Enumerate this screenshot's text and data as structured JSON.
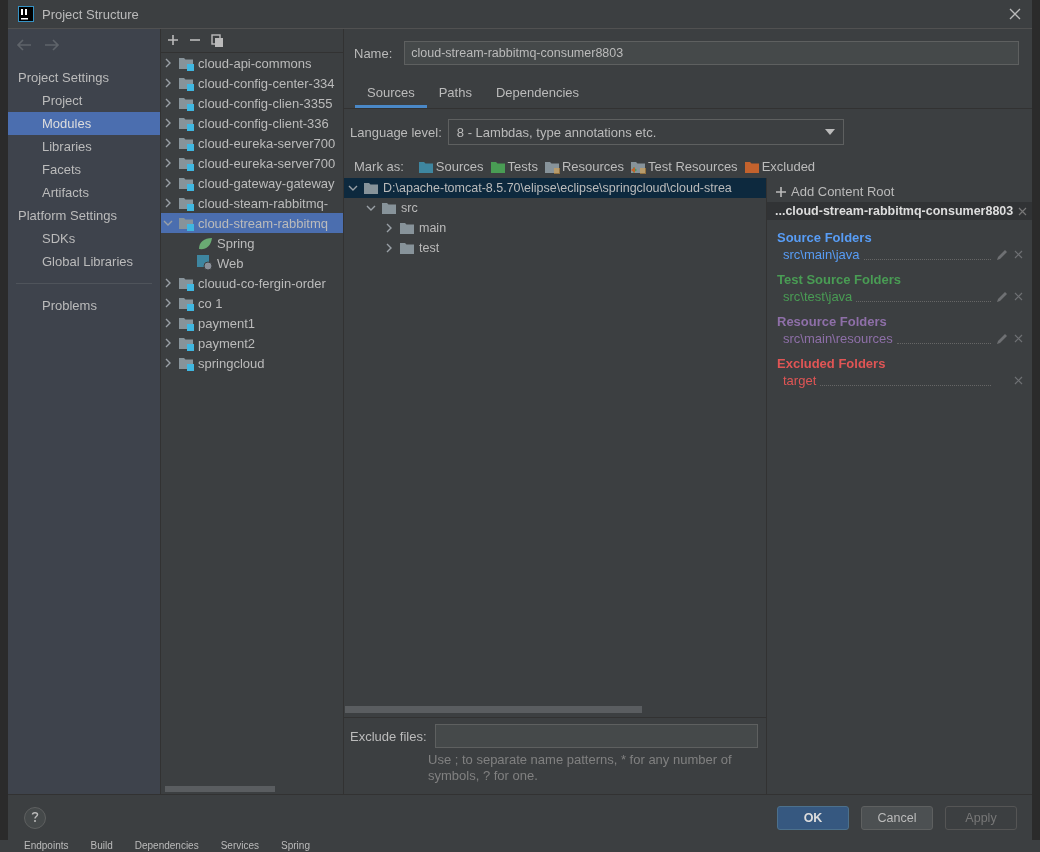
{
  "window": {
    "title": "Project Structure"
  },
  "nav": {
    "sections": [
      {
        "heading": "Project Settings",
        "items": [
          {
            "label": "Project",
            "selected": false
          },
          {
            "label": "Modules",
            "selected": true
          },
          {
            "label": "Libraries",
            "selected": false
          },
          {
            "label": "Facets",
            "selected": false
          },
          {
            "label": "Artifacts",
            "selected": false
          }
        ]
      },
      {
        "heading": "Platform Settings",
        "items": [
          {
            "label": "SDKs",
            "selected": false
          },
          {
            "label": "Global Libraries",
            "selected": false
          }
        ]
      }
    ],
    "extra_items": [
      {
        "label": "Problems",
        "selected": false
      }
    ]
  },
  "modules": [
    {
      "label": "cloud-api-commons",
      "expanded": false,
      "selected": false
    },
    {
      "label": "cloud-config-center-334",
      "expanded": false,
      "selected": false
    },
    {
      "label": "cloud-config-clien-3355",
      "expanded": false,
      "selected": false
    },
    {
      "label": "cloud-config-client-336",
      "expanded": false,
      "selected": false
    },
    {
      "label": "cloud-eureka-server700",
      "expanded": false,
      "selected": false
    },
    {
      "label": "cloud-eureka-server700",
      "expanded": false,
      "selected": false
    },
    {
      "label": "cloud-gateway-gateway",
      "expanded": false,
      "selected": false
    },
    {
      "label": "cloud-steam-rabbitmq-",
      "expanded": false,
      "selected": false
    },
    {
      "label": "cloud-stream-rabbitmq",
      "expanded": true,
      "selected": true,
      "children": [
        {
          "label": "Spring",
          "kind": "spring"
        },
        {
          "label": "Web",
          "kind": "web"
        }
      ]
    },
    {
      "label": "clouud-co-fergin-order",
      "expanded": false,
      "selected": false
    },
    {
      "label": "co 1",
      "expanded": false,
      "selected": false
    },
    {
      "label": "payment1",
      "expanded": false,
      "selected": false
    },
    {
      "label": "payment2",
      "expanded": false,
      "selected": false
    },
    {
      "label": "springcloud",
      "expanded": false,
      "selected": false
    }
  ],
  "name_field": {
    "label": "Name:",
    "value": "cloud-stream-rabbitmq-consumer8803"
  },
  "tabs": [
    {
      "label": "Sources",
      "selected": true
    },
    {
      "label": "Paths",
      "selected": false
    },
    {
      "label": "Dependencies",
      "selected": false
    }
  ],
  "language_level": {
    "label": "Language level:",
    "value": "8 - Lambdas, type annotations etc."
  },
  "mark_as": {
    "label": "Mark as:",
    "items": [
      {
        "label": "Sources",
        "kind": "plain",
        "color": "#3e86a0"
      },
      {
        "label": "Tests",
        "kind": "plain",
        "color": "#499c54"
      },
      {
        "label": "Resources",
        "kind": "resources",
        "color": "#87939a"
      },
      {
        "label": "Test Resources",
        "kind": "test-resources",
        "color": "#87939a"
      },
      {
        "label": "Excluded",
        "kind": "plain",
        "color": "#c3622d"
      }
    ]
  },
  "content_tree": [
    {
      "label": "D:\\apache-tomcat-8.5.70\\elipse\\eclipse\\springcloud\\cloud-strea",
      "expanded": true,
      "selected": true,
      "children": [
        {
          "label": "src",
          "expanded": true,
          "selected": false,
          "children": [
            {
              "label": "main",
              "expanded": false,
              "selected": false
            },
            {
              "label": "test",
              "expanded": false,
              "selected": false
            }
          ]
        }
      ]
    }
  ],
  "content_root": {
    "add_label": "Add Content Root",
    "root": "...cloud-stream-rabbitmq-consumer8803",
    "groups": [
      {
        "title": "Source Folders",
        "color": "#589df6",
        "folders": [
          {
            "path": "src\\main\\java",
            "editable": true
          }
        ]
      },
      {
        "title": "Test Source Folders",
        "color": "#499c54",
        "folders": [
          {
            "path": "src\\test\\java",
            "editable": true
          }
        ]
      },
      {
        "title": "Resource Folders",
        "color": "#8e6fa8",
        "folders": [
          {
            "path": "src\\main\\resources",
            "editable": true
          }
        ]
      },
      {
        "title": "Excluded Folders",
        "color": "#e05555",
        "folders": [
          {
            "path": "target",
            "editable": false
          }
        ]
      }
    ]
  },
  "exclude_files": {
    "label": "Exclude files:",
    "hint": "Use ; to separate name patterns, * for any number of symbols, ? for one."
  },
  "buttons": [
    {
      "label": "OK",
      "kind": "primary",
      "disabled": false
    },
    {
      "label": "Cancel",
      "kind": "normal",
      "disabled": false
    },
    {
      "label": "Apply",
      "kind": "normal",
      "disabled": true
    }
  ],
  "tool_windows": [
    "Endpoints",
    "Build",
    "Dependencies",
    "Services",
    "Spring"
  ]
}
